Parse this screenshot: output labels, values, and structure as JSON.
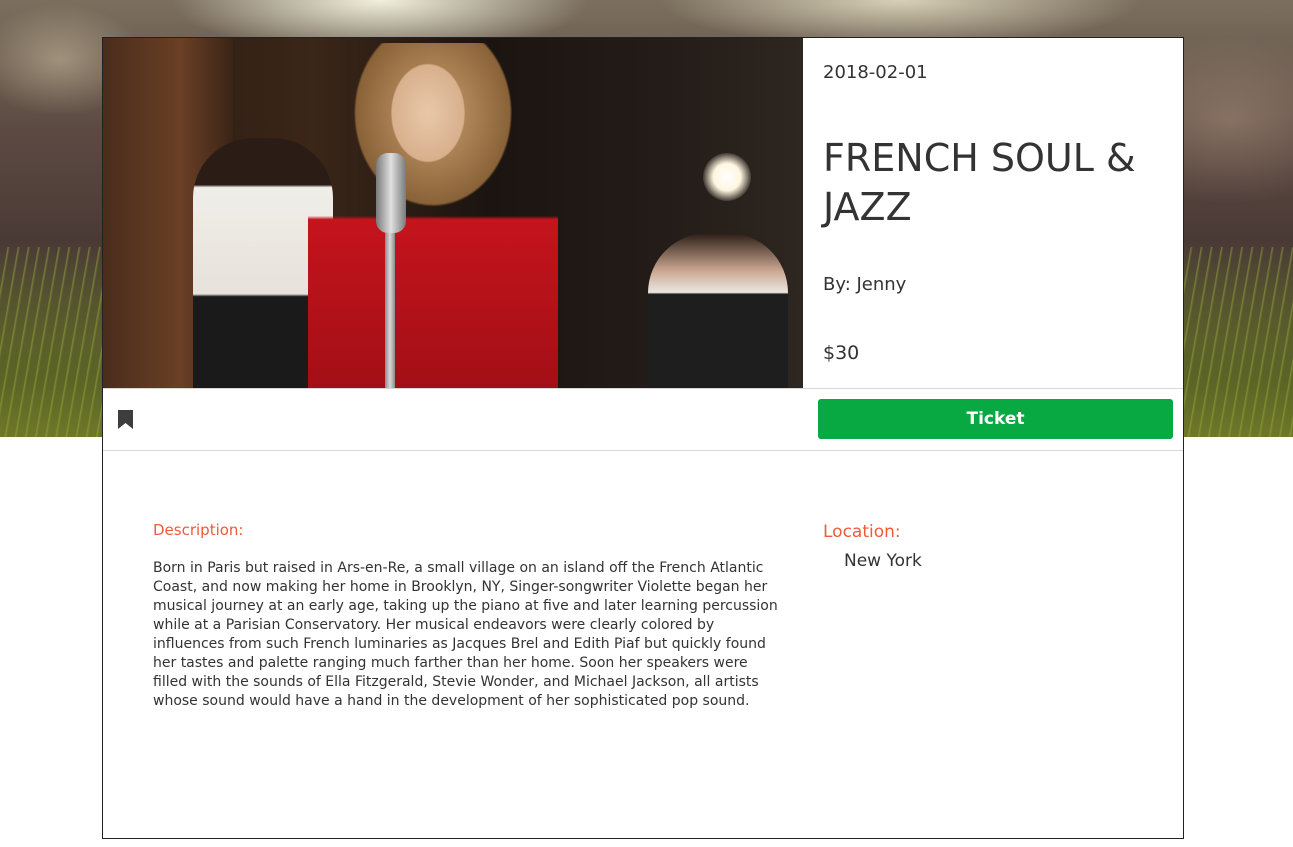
{
  "event": {
    "date": "2018-02-01",
    "title": "FRENCH SOUL & JAZZ",
    "author": "By: Jenny",
    "price": "$30"
  },
  "actions": {
    "bookmark_icon": "bookmark-icon",
    "ticket_label": "Ticket"
  },
  "details": {
    "description_label": "Description:",
    "description": "Born in Paris but raised in Ars-en-Re, a small village on an island off the French Atlantic Coast, and now making her home in Brooklyn, NY, Singer-songwriter Violette began her musical journey at an early age, taking up the piano at five and later learning percussion while at a Parisian Conservatory. Her musical endeavors were clearly colored by influences from such French luminaries as Jacques Brel and Edith Piaf but quickly found her tastes and palette ranging much farther than her home. Soon her speakers were filled with the sounds of Ella Fitzgerald, Stevie Wonder, and Michael Jackson, all artists whose sound would have a hand in the development of her sophisticated pop sound.",
    "location_label": "Location:",
    "location": "New York"
  },
  "colors": {
    "accent": "#ee5a3a",
    "ticket_button": "#08a842",
    "text": "#333333"
  }
}
